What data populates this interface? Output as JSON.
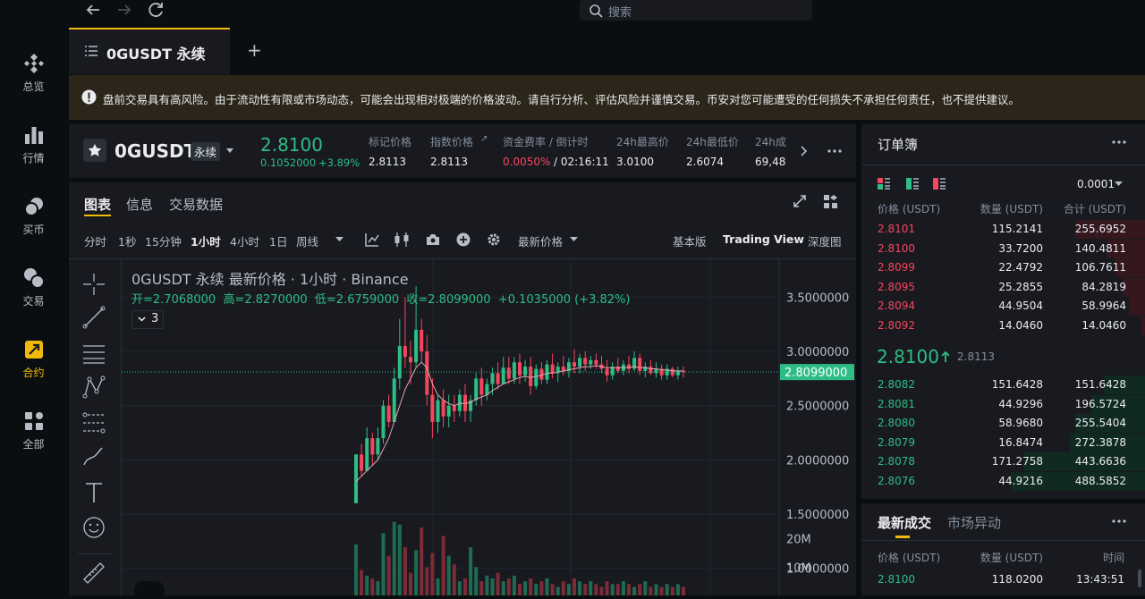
{
  "topbar": {
    "search_placeholder": "搜索"
  },
  "sidebar": [
    {
      "label": "总览",
      "icon": "binance-logo-icon"
    },
    {
      "label": "行情",
      "icon": "bar-chart-icon"
    },
    {
      "label": "买币",
      "icon": "coins-icon"
    },
    {
      "label": "交易",
      "icon": "exchange-icon"
    },
    {
      "label": "合约",
      "icon": "futures-icon"
    },
    {
      "label": "全部",
      "icon": "grid-icon"
    }
  ],
  "tab": {
    "label": "0GUSDT 永续",
    "add": "+"
  },
  "warning": "盘前交易具有高风险。由于流动性有限或市场动态，可能会出现相对极端的价格波动。请自行分析、评估风险并谨慎交易。币安对您可能遭受的任何损失不承担任何责任，也不提供建议。",
  "ticker": {
    "symbol": "0GUSDT",
    "type": "永续",
    "price": "2.8100",
    "change": "0.1052000",
    "change_pct": "+3.89%",
    "stats": [
      {
        "label": "标记价格",
        "value": "2.8113"
      },
      {
        "label": "指数价格",
        "value": "2.8113"
      },
      {
        "label": "资金费率 / 倒计时",
        "value_rate": "0.0050%",
        "value_cd": "02:16:11"
      },
      {
        "label": "24h最高价",
        "value": "3.0100"
      },
      {
        "label": "24h最低价",
        "value": "2.6074"
      },
      {
        "label": "24h成",
        "value": "69,48"
      }
    ]
  },
  "chart_tabs": [
    "图表",
    "信息",
    "交易数据"
  ],
  "toolbar": {
    "intervals": [
      "分时",
      "1秒",
      "15分钟",
      "1小时",
      "4小时",
      "1日",
      "周线"
    ],
    "active_interval": "1小时",
    "price_type": "最新价格",
    "views": [
      "基本版",
      "Trading View",
      "深度图"
    ]
  },
  "chart_legend": {
    "title": "0GUSDT 永续 最新价格 · 1小时 · Binance",
    "ohlc": "开=2.7068000  高=2.8270000  低=2.6759000  收=2.8099000  +0.1035000 (+3.82%)",
    "indicators_count": "3"
  },
  "chart_data": {
    "type": "candlestick",
    "price_axis_ticks": [
      "3.5000000",
      "3.0000000",
      "2.5000000",
      "2.0000000",
      "1.5000000",
      "1.0000000"
    ],
    "volume_axis_ticks": [
      "20M",
      "10M"
    ],
    "last_price_label": "2.8099000",
    "ylim": [
      0.75,
      3.85
    ],
    "candles": [
      [
        1.6,
        2.05,
        1.6,
        2.05
      ],
      [
        2.05,
        2.15,
        1.85,
        1.9
      ],
      [
        1.9,
        2.3,
        1.9,
        2.2
      ],
      [
        2.2,
        2.25,
        1.95,
        2.05
      ],
      [
        2.05,
        2.3,
        2.0,
        2.2
      ],
      [
        2.2,
        2.55,
        2.15,
        2.5
      ],
      [
        2.5,
        2.6,
        2.3,
        2.35
      ],
      [
        2.35,
        2.85,
        2.35,
        2.75
      ],
      [
        2.75,
        3.3,
        2.65,
        3.05
      ],
      [
        3.05,
        3.5,
        2.85,
        2.95
      ],
      [
        2.95,
        3.1,
        2.7,
        2.9
      ],
      [
        2.9,
        3.6,
        2.85,
        3.2
      ],
      [
        3.2,
        3.3,
        2.9,
        3.0
      ],
      [
        3.0,
        3.15,
        2.5,
        2.6
      ],
      [
        2.6,
        2.75,
        2.2,
        2.35
      ],
      [
        2.35,
        2.6,
        2.25,
        2.55
      ],
      [
        2.55,
        2.65,
        2.3,
        2.4
      ],
      [
        2.4,
        2.6,
        2.3,
        2.5
      ],
      [
        2.5,
        2.6,
        2.35,
        2.45
      ],
      [
        2.45,
        2.65,
        2.4,
        2.6
      ],
      [
        2.6,
        2.7,
        2.35,
        2.45
      ],
      [
        2.45,
        2.6,
        2.35,
        2.55
      ],
      [
        2.55,
        2.8,
        2.5,
        2.75
      ],
      [
        2.75,
        2.85,
        2.5,
        2.6
      ],
      [
        2.6,
        2.75,
        2.55,
        2.7
      ],
      [
        2.7,
        2.85,
        2.6,
        2.8
      ],
      [
        2.8,
        2.9,
        2.65,
        2.7
      ],
      [
        2.7,
        2.95,
        2.7,
        2.85
      ],
      [
        2.85,
        2.95,
        2.7,
        2.75
      ],
      [
        2.75,
        2.95,
        2.7,
        2.9
      ],
      [
        2.9,
        2.98,
        2.7,
        2.78
      ],
      [
        2.78,
        2.92,
        2.72,
        2.86
      ],
      [
        2.86,
        2.95,
        2.6,
        2.68
      ],
      [
        2.68,
        2.88,
        2.65,
        2.84
      ],
      [
        2.84,
        2.9,
        2.7,
        2.74
      ],
      [
        2.74,
        2.92,
        2.7,
        2.88
      ],
      [
        2.88,
        2.98,
        2.75,
        2.8
      ],
      [
        2.8,
        2.9,
        2.72,
        2.86
      ],
      [
        2.86,
        2.96,
        2.78,
        2.82
      ],
      [
        2.82,
        2.94,
        2.76,
        2.9
      ],
      [
        2.9,
        3.02,
        2.8,
        2.86
      ],
      [
        2.86,
        2.98,
        2.8,
        2.94
      ],
      [
        2.94,
        3.0,
        2.82,
        2.88
      ],
      [
        2.88,
        2.96,
        2.84,
        2.92
      ],
      [
        2.92,
        2.98,
        2.84,
        2.88
      ],
      [
        2.88,
        2.96,
        2.8,
        2.84
      ],
      [
        2.84,
        2.92,
        2.72,
        2.78
      ],
      [
        2.78,
        2.9,
        2.74,
        2.86
      ],
      [
        2.86,
        2.94,
        2.8,
        2.82
      ],
      [
        2.82,
        2.92,
        2.78,
        2.88
      ],
      [
        2.88,
        2.96,
        2.8,
        2.84
      ],
      [
        2.84,
        3.0,
        2.82,
        2.94
      ],
      [
        2.94,
        2.98,
        2.78,
        2.82
      ],
      [
        2.82,
        2.9,
        2.76,
        2.86
      ],
      [
        2.86,
        2.92,
        2.78,
        2.8
      ],
      [
        2.8,
        2.9,
        2.76,
        2.84
      ],
      [
        2.84,
        2.88,
        2.74,
        2.78
      ],
      [
        2.78,
        2.88,
        2.74,
        2.84
      ],
      [
        2.84,
        2.86,
        2.76,
        2.78
      ],
      [
        2.78,
        2.86,
        2.74,
        2.82
      ],
      [
        2.82,
        2.86,
        2.76,
        2.81
      ]
    ],
    "volumes_M": [
      18,
      9,
      7,
      6,
      5,
      22,
      14,
      26,
      25,
      17,
      8,
      16,
      24,
      10,
      15,
      6,
      21,
      14,
      11,
      5,
      6,
      17,
      10,
      5,
      7,
      6,
      8,
      5,
      6,
      7,
      4,
      5,
      6,
      4,
      5,
      6,
      4,
      3,
      5,
      4,
      6,
      5,
      4,
      5,
      4,
      3,
      5,
      4,
      4,
      5,
      4,
      3,
      4,
      5,
      3,
      4,
      3,
      4,
      3,
      4,
      3
    ],
    "ma": [
      1.8,
      1.85,
      1.9,
      1.95,
      2.0,
      2.1,
      2.2,
      2.35,
      2.5,
      2.65,
      2.75,
      2.85,
      2.9,
      2.85,
      2.7,
      2.6,
      2.55,
      2.52,
      2.5,
      2.52,
      2.52,
      2.53,
      2.56,
      2.58,
      2.6,
      2.64,
      2.67,
      2.7,
      2.72,
      2.74,
      2.76,
      2.77,
      2.76,
      2.77,
      2.78,
      2.8,
      2.8,
      2.81,
      2.82,
      2.83,
      2.84,
      2.85,
      2.86,
      2.86,
      2.87,
      2.86,
      2.85,
      2.85,
      2.85,
      2.85,
      2.85,
      2.86,
      2.85,
      2.85,
      2.84,
      2.84,
      2.83,
      2.83,
      2.82,
      2.82,
      2.82
    ]
  },
  "orderbook": {
    "title": "订单簿",
    "precision": "0.0001",
    "headers": [
      "价格 (USDT)",
      "数量 (USDT)",
      "合计 (USDT)"
    ],
    "asks": [
      {
        "p": "2.8101",
        "q": "115.2141",
        "t": "255.6952",
        "d": 0.52
      },
      {
        "p": "2.8100",
        "q": "33.7200",
        "t": "140.4811",
        "d": 0.29
      },
      {
        "p": "2.8099",
        "q": "22.4792",
        "t": "106.7611",
        "d": 0.22
      },
      {
        "p": "2.8095",
        "q": "25.2855",
        "t": "84.2819",
        "d": 0.17
      },
      {
        "p": "2.8094",
        "q": "44.9504",
        "t": "58.9964",
        "d": 0.12
      },
      {
        "p": "2.8092",
        "q": "14.0460",
        "t": "14.0460",
        "d": 0.03
      }
    ],
    "last_price": "2.8100",
    "mark_price": "2.8113",
    "bids": [
      {
        "p": "2.8082",
        "q": "151.6428",
        "t": "151.6428",
        "d": 0.31
      },
      {
        "p": "2.8081",
        "q": "44.9296",
        "t": "196.5724",
        "d": 0.4
      },
      {
        "p": "2.8080",
        "q": "58.9680",
        "t": "255.5404",
        "d": 0.52
      },
      {
        "p": "2.8079",
        "q": "16.8474",
        "t": "272.3878",
        "d": 0.56
      },
      {
        "p": "2.8078",
        "q": "171.2758",
        "t": "443.6636",
        "d": 0.91
      },
      {
        "p": "2.8076",
        "q": "44.9216",
        "t": "488.5852",
        "d": 1.0
      }
    ]
  },
  "trades": {
    "tabs": [
      "最新成交",
      "市场异动"
    ],
    "headers": [
      "价格 (USDT)",
      "数量 (USDT)",
      "时间"
    ],
    "rows": [
      {
        "p": "2.8100",
        "q": "118.0200",
        "t": "13:43:51"
      }
    ]
  }
}
